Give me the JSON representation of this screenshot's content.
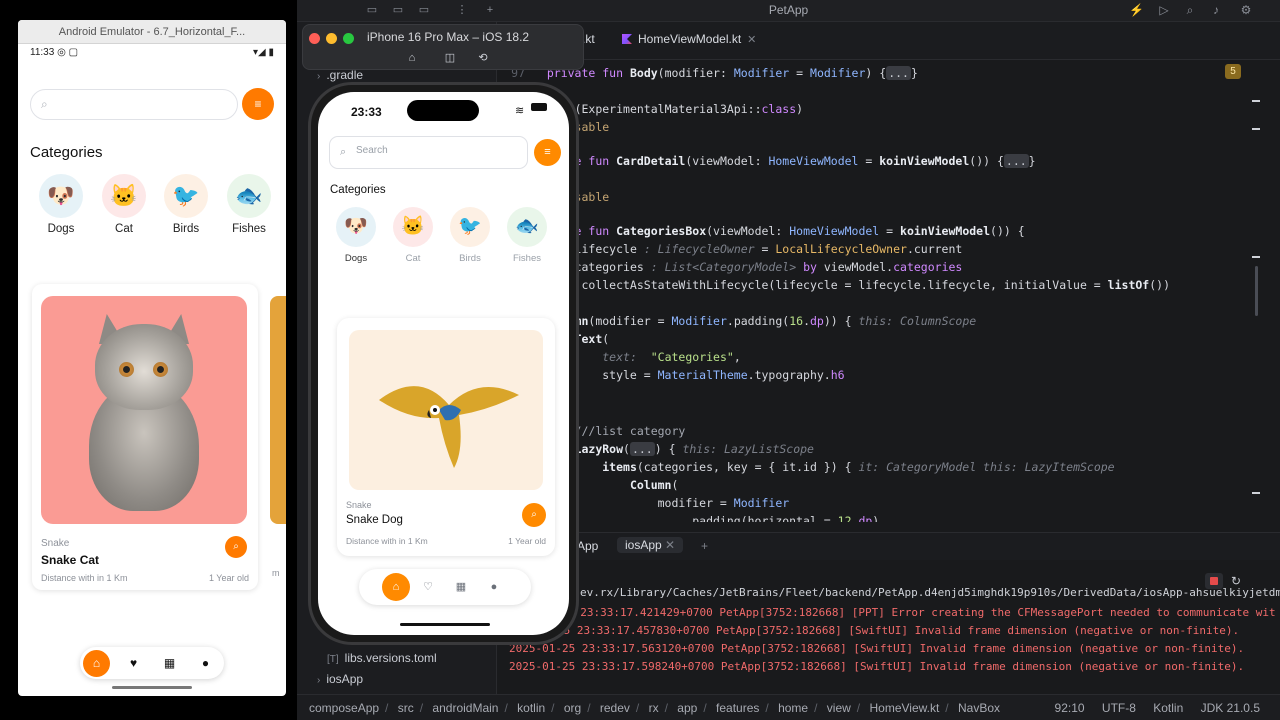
{
  "android": {
    "window_title": "Android Emulator - 6.7_Horizontal_F...",
    "status_time": "11:33",
    "status_icons": "◎ ▢",
    "status_right": "▾◢ ▮",
    "search_placeholder": "",
    "categories_title": "Categories",
    "categories": [
      {
        "label": "Dogs",
        "icon": "🐶",
        "bg": "#e6f2f7"
      },
      {
        "label": "Cat",
        "icon": "🐱",
        "bg": "#fde8e8"
      },
      {
        "label": "Birds",
        "icon": "🐦",
        "bg": "#fdf0e4"
      },
      {
        "label": "Fishes",
        "icon": "🐟",
        "bg": "#e9f6ea"
      }
    ],
    "card": {
      "type": "Snake",
      "name": "Snake Cat",
      "distance": "Distance with in 1 Km",
      "age": "1 Year old"
    },
    "next_card_fragment": "m",
    "nav": [
      "home-icon",
      "heart-icon",
      "calendar-icon",
      "person-icon"
    ]
  },
  "ios": {
    "toolbar_title": "iPhone 16 Pro Max – iOS 18.2",
    "time": "23:33",
    "search_placeholder": "Search",
    "categories_title": "Categories",
    "categories": [
      {
        "label": "Dogs",
        "icon": "🐶",
        "bg": "#e6f2f7"
      },
      {
        "label": "Cat",
        "icon": "🐱",
        "bg": "#fde8e8"
      },
      {
        "label": "Birds",
        "icon": "🐦",
        "bg": "#fdf0e4"
      },
      {
        "label": "Fishes",
        "icon": "🐟",
        "bg": "#e9f6ea"
      }
    ],
    "card": {
      "type": "Snake",
      "name": "Snake Dog",
      "distance": "Distance with in 1 Km",
      "age": "1 Year old"
    }
  },
  "ide": {
    "title": "PetApp",
    "tabs": [
      {
        "label": ".kt"
      },
      {
        "label": "HomeViewModel.kt"
      }
    ],
    "tree": [
      {
        "label": ".gradle",
        "prefix": "›"
      },
      {
        "label": "libs.versions.toml",
        "prefix": "[T]"
      },
      {
        "label": "iosApp",
        "prefix": "›"
      }
    ],
    "warning_count": "5",
    "line_number": "97",
    "terminal_tabs": [
      "App",
      "iosApp"
    ],
    "terminal_path_fragment": "ev.rx/Library/Caches/JetBrains/Fleet/backend/PetApp.d4enjd5imghdk19p910s/DerivedData/iosApp-ahsuelkiyjetdm",
    "terminal_lines": [
      {
        "text": "5 23:33:17.421429+0700 PetApp[3752:182668] [PPT] Error creating the CFMessagePort needed to communicate wit"
      },
      {
        "text": "25 23:33:17.457830+0700 PetApp[3752:182668] [SwiftUI] Invalid frame dimension (negative or non-finite)."
      },
      {
        "text": "2025-01-25 23:33:17.563120+0700 PetApp[3752:182668] [SwiftUI] Invalid frame dimension (negative or non-finite)."
      },
      {
        "text": "2025-01-25 23:33:17.598240+0700 PetApp[3752:182668] [SwiftUI] Invalid frame dimension (negative or non-finite)."
      }
    ],
    "breadcrumb": [
      "composeApp",
      "src",
      "androidMain",
      "kotlin",
      "org",
      "redev",
      "rx",
      "app",
      "features",
      "home",
      "view",
      "HomeView.kt",
      "NavBox"
    ],
    "status": {
      "position": "92:10",
      "encoding": "UTF-8",
      "language": "Kotlin",
      "jdk": "JDK 21.0.5"
    }
  },
  "colors": {
    "accent": "#ff8a00",
    "error": "#f06a6a"
  }
}
